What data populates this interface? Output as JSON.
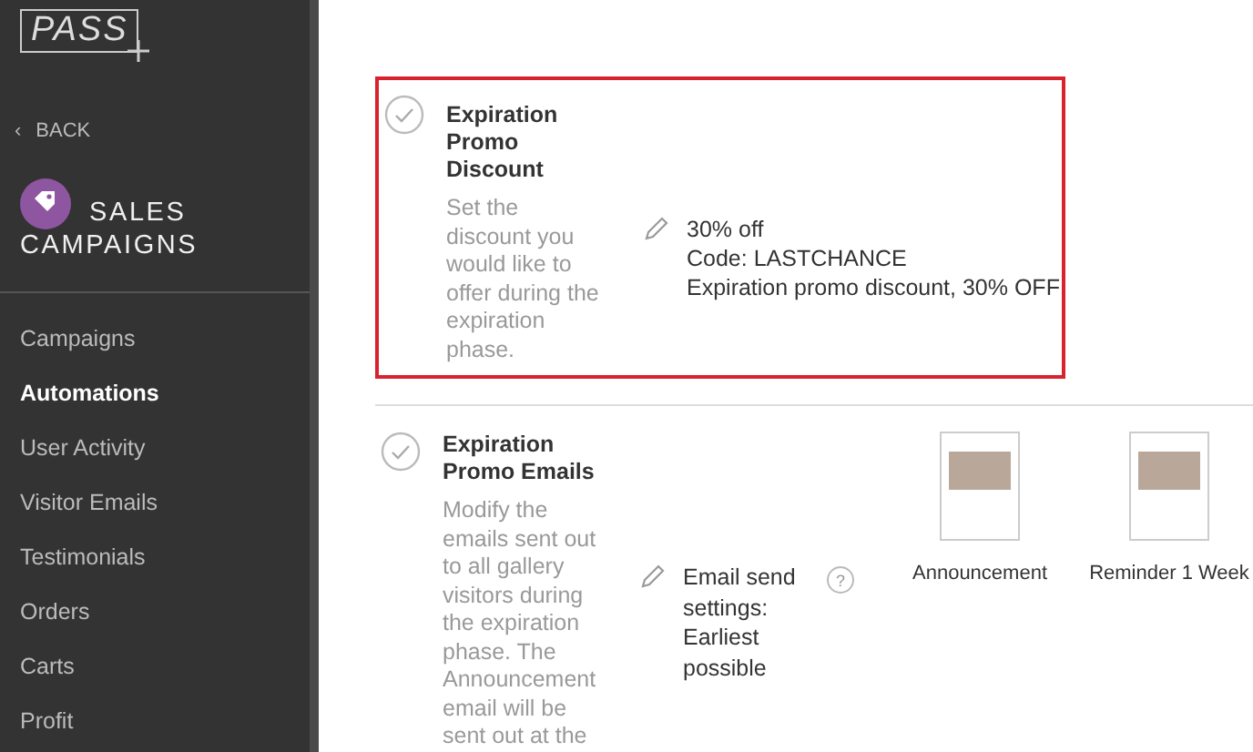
{
  "sidebar": {
    "logo": "PASS",
    "back": {
      "icon": "‹",
      "label": "BACK"
    },
    "section_title": [
      "SALES",
      "CAMPAIGNS"
    ],
    "items": [
      {
        "label": "Campaigns",
        "selected": false
      },
      {
        "label": "Automations",
        "selected": true
      },
      {
        "label": "User Activity",
        "selected": false
      },
      {
        "label": "Visitor Emails",
        "selected": false
      },
      {
        "label": "Testimonials",
        "selected": false
      },
      {
        "label": "Orders",
        "selected": false
      },
      {
        "label": "Carts",
        "selected": false
      },
      {
        "label": "Profit",
        "selected": false
      }
    ]
  },
  "automations": [
    {
      "kind": "discount",
      "highlighted": true,
      "title": "Expiration Promo Discount",
      "description": "Set the discount you would like to offer during the expiration phase.",
      "details": [
        "30% off",
        "Code: LASTCHANCE",
        "Expiration promo discount, 30% OFF"
      ]
    },
    {
      "kind": "emails",
      "highlighted": false,
      "title": "Expiration Promo Emails",
      "description": "Modify the emails sent out to all gallery visitors during the expiration phase. The Announcement email will be sent out at the",
      "settings": "Email send settings: Earliest possible",
      "help": "?",
      "emails": [
        {
          "label": "Announcement"
        },
        {
          "label": "Reminder 1 Week"
        }
      ]
    }
  ]
}
